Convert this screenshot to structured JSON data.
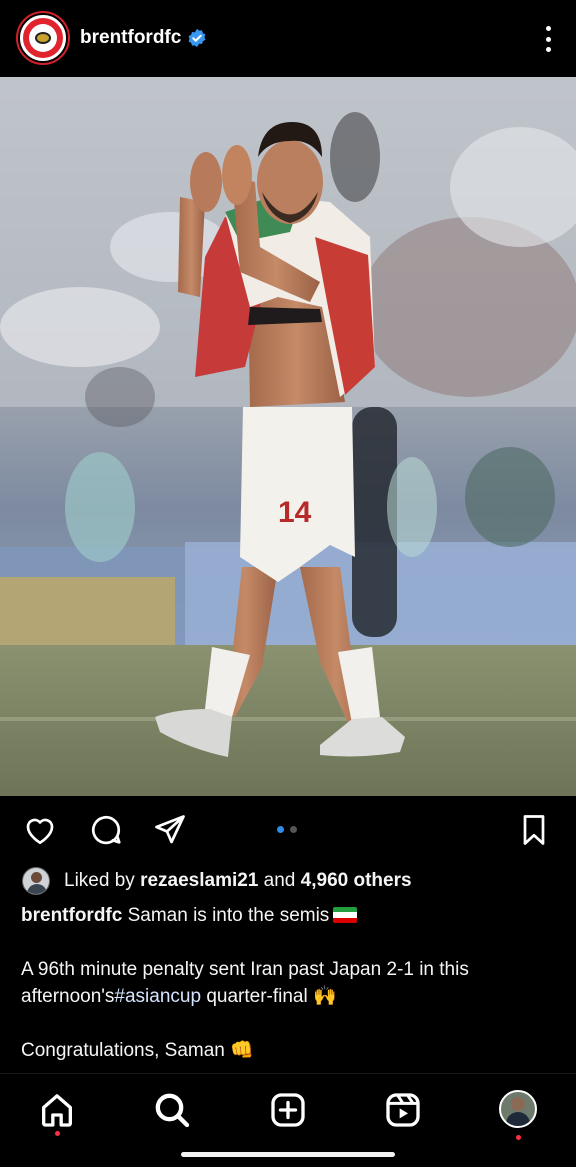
{
  "header": {
    "username": "brentfordfc",
    "verified": true,
    "more_icon": "more-vertical-icon"
  },
  "post": {
    "image_description_icon": "photo",
    "carousel": {
      "count": 2,
      "active": 1
    },
    "actions": [
      "heart-icon",
      "comment-icon",
      "share-icon",
      "bookmark-icon"
    ],
    "player_number": "14"
  },
  "likes": {
    "prefix": "Liked by",
    "user": "rezaeslami21",
    "middle": "and",
    "others": "4,960 others"
  },
  "caption": {
    "author": "brentfordfc",
    "line1": "Saman is into the semis",
    "para2_a": "A 96th minute penalty sent Iran past Japan 2-1 in this afternoon's",
    "hashtag": "#asiancup",
    "para2_b": "quarter-final",
    "para3": "Congratulations, Saman"
  },
  "nav": {
    "items": [
      "home-icon",
      "search-icon",
      "create-icon",
      "reels-icon",
      "profile-avatar"
    ]
  },
  "colors": {
    "background": "#000000",
    "verified_blue": "#3897f0",
    "notification_red": "#ff3040",
    "brand_red": "#e0232d"
  }
}
